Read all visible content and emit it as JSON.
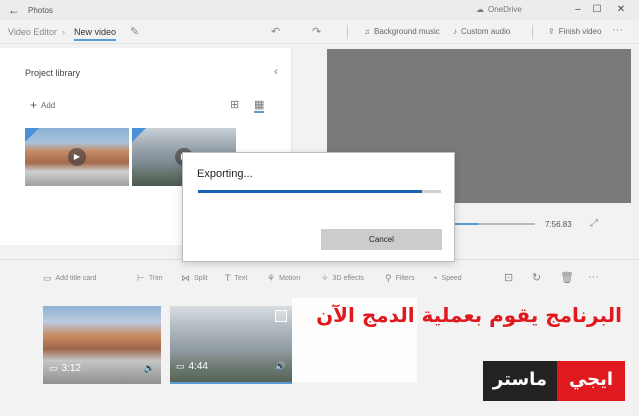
{
  "window": {
    "back_icon": "back-arrow-icon",
    "app_name": "Photos",
    "onedrive_label": "OneDrive",
    "controls": [
      "minimize-icon",
      "maximize-icon",
      "close-icon"
    ]
  },
  "toolbar": {
    "breadcrumb_root": "Video Editor",
    "breadcrumb_sep": "›",
    "breadcrumb_current": "New video",
    "background_music": "Background music",
    "custom_audio": "Custom audio",
    "finish_video": "Finish video",
    "more": "···"
  },
  "library": {
    "title": "Project library",
    "add_label": "Add",
    "items": [
      "desert-clip",
      "cloud-clip"
    ]
  },
  "preview": {
    "time": "7:56.83",
    "progress": 0.3
  },
  "storyboard_tools": {
    "add_title_card": "Add title card",
    "trim": "Trim",
    "split": "Split",
    "text": "Text",
    "motion": "Motion",
    "effects_3d": "3D effects",
    "filters": "Filters",
    "speed": "Speed",
    "more": "···"
  },
  "storyboard": {
    "clips": [
      {
        "duration": "3:12"
      },
      {
        "duration": "4:44"
      }
    ]
  },
  "overlay": {
    "caption": "البرنامج يقوم بعملية الدمج الآن",
    "logo_left": "ماستر",
    "logo_right": "ايجي"
  },
  "dialog": {
    "title": "Exporting...",
    "progress": 0.92,
    "cancel_label": "Cancel"
  },
  "colors": {
    "accent": "#5b9bd5",
    "progress": "#1a60b5",
    "caption_red": "#e0191f"
  }
}
